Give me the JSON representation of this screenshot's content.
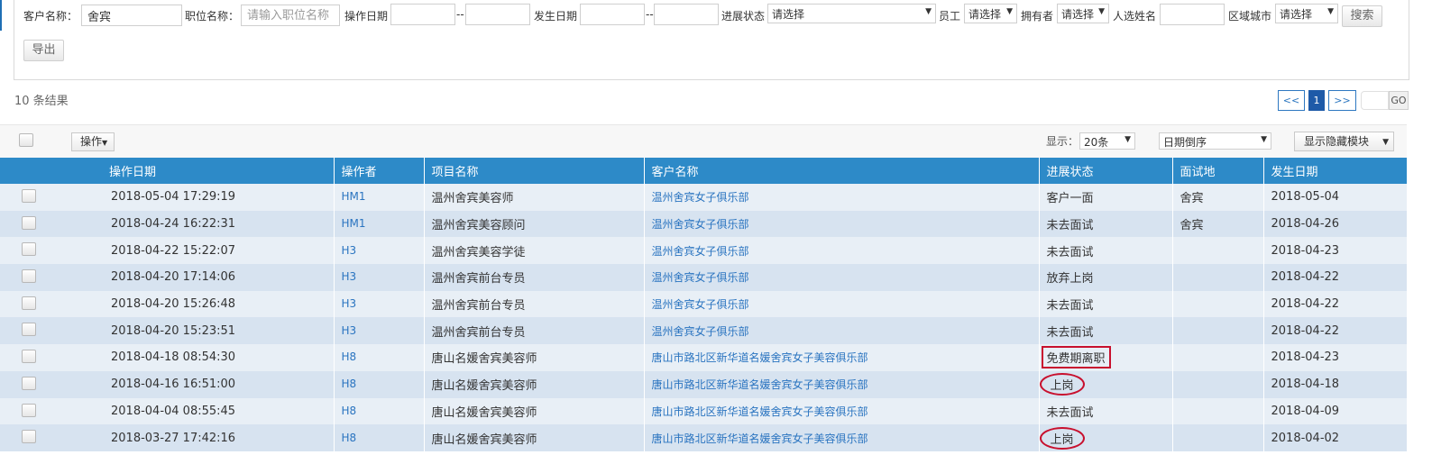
{
  "filters": {
    "customer_label": "客户名称：",
    "customer_value": "舍宾",
    "position_label": "职位名称：",
    "position_placeholder": "请输入职位名称",
    "op_date_label": "操作日期",
    "range_sep": "--",
    "occur_date_label": "发生日期",
    "status_label": "进展状态",
    "status_value": "请选择",
    "employee_label": "员工",
    "employee_value": "请选择",
    "owner_label": "拥有者",
    "owner_value": "请选择",
    "candidate_label": "人选姓名",
    "city_label": "区域城市",
    "city_value": "请选择",
    "search_button": "搜索",
    "export_button": "导出"
  },
  "results": {
    "count_text": "10 条结果"
  },
  "pagination": {
    "prev": "<<",
    "current": "1",
    "next": ">>",
    "go": "GO"
  },
  "toolbar": {
    "ops_label": "操作",
    "display_label": "显示：",
    "page_size": "20条",
    "sort_value": "日期倒序",
    "hidden_module_label": "显示隐藏模块"
  },
  "table": {
    "columns": [
      "操作日期",
      "操作者",
      "项目名称",
      "客户名称",
      "进展状态",
      "面试地",
      "发生日期"
    ],
    "rows": [
      {
        "op_date": "2018-05-04 17:29:19",
        "operator": "HM1",
        "project": "温州舍宾美容师",
        "customer": "温州舍宾女子俱乐部",
        "status": "客户一面",
        "location": "舍宾",
        "occur_date": "2018-05-04",
        "mark": ""
      },
      {
        "op_date": "2018-04-24 16:22:31",
        "operator": "HM1",
        "project": "温州舍宾美容顾问",
        "customer": "温州舍宾女子俱乐部",
        "status": "未去面试",
        "location": "舍宾",
        "occur_date": "2018-04-26",
        "mark": ""
      },
      {
        "op_date": "2018-04-22 15:22:07",
        "operator": "H3",
        "project": "温州舍宾美容学徒",
        "customer": "温州舍宾女子俱乐部",
        "status": "未去面试",
        "location": "",
        "occur_date": "2018-04-23",
        "mark": ""
      },
      {
        "op_date": "2018-04-20 17:14:06",
        "operator": "H3",
        "project": "温州舍宾前台专员",
        "customer": "温州舍宾女子俱乐部",
        "status": "放弃上岗",
        "location": "",
        "occur_date": "2018-04-22",
        "mark": ""
      },
      {
        "op_date": "2018-04-20 15:26:48",
        "operator": "H3",
        "project": "温州舍宾前台专员",
        "customer": "温州舍宾女子俱乐部",
        "status": "未去面试",
        "location": "",
        "occur_date": "2018-04-22",
        "mark": ""
      },
      {
        "op_date": "2018-04-20 15:23:51",
        "operator": "H3",
        "project": "温州舍宾前台专员",
        "customer": "温州舍宾女子俱乐部",
        "status": "未去面试",
        "location": "",
        "occur_date": "2018-04-22",
        "mark": ""
      },
      {
        "op_date": "2018-04-18 08:54:30",
        "operator": "H8",
        "project": "唐山名媛舍宾美容师",
        "customer": "唐山市路北区新华道名媛舍宾女子美容俱乐部",
        "status": "免费期离职",
        "location": "",
        "occur_date": "2018-04-23",
        "mark": "box"
      },
      {
        "op_date": "2018-04-16 16:51:00",
        "operator": "H8",
        "project": "唐山名媛舍宾美容师",
        "customer": "唐山市路北区新华道名媛舍宾女子美容俱乐部",
        "status": "上岗",
        "location": "",
        "occur_date": "2018-04-18",
        "mark": "oval"
      },
      {
        "op_date": "2018-04-04 08:55:45",
        "operator": "H8",
        "project": "唐山名媛舍宾美容师",
        "customer": "唐山市路北区新华道名媛舍宾女子美容俱乐部",
        "status": "未去面试",
        "location": "",
        "occur_date": "2018-04-09",
        "mark": ""
      },
      {
        "op_date": "2018-03-27 17:42:16",
        "operator": "H8",
        "project": "唐山名媛舍宾美容师",
        "customer": "唐山市路北区新华道名媛舍宾女子美容俱乐部",
        "status": "上岗",
        "location": "",
        "occur_date": "2018-04-02",
        "mark": "oval"
      }
    ]
  },
  "colors": {
    "header_blue": "#2d8ac8",
    "link_blue": "#2a74c0",
    "highlight_red": "#c8102e",
    "row_light": "#e8eff6",
    "row_dark": "#d7e3f0"
  }
}
